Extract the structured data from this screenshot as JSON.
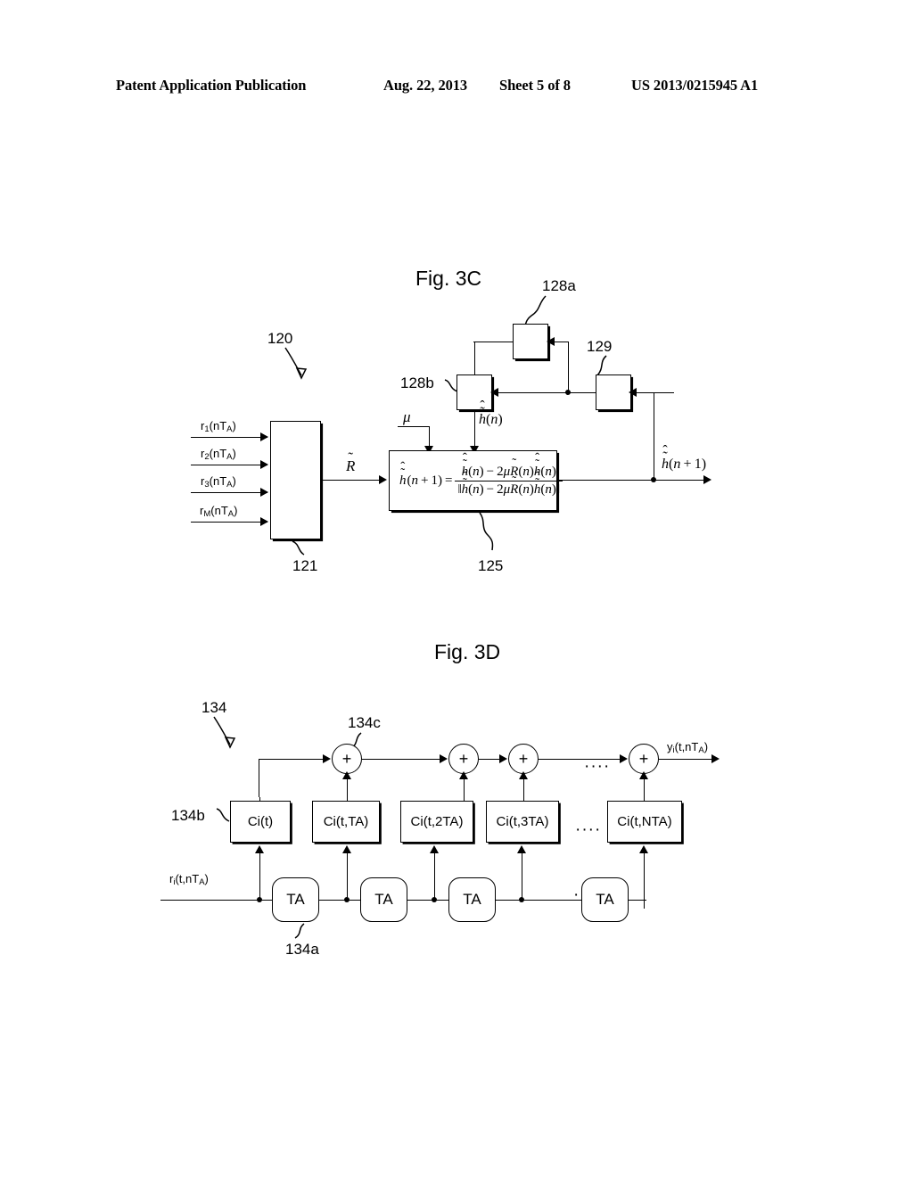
{
  "header": {
    "publication": "Patent Application Publication",
    "date": "Aug. 22, 2013",
    "sheet": "Sheet 5 of 8",
    "patent_number": "US 2013/0215945 A1"
  },
  "fig3c": {
    "title": "Fig. 3C",
    "refs": {
      "system": "120",
      "correlator": "121",
      "update_block": "125",
      "delay_128a": "128a",
      "delay_128b": "128b",
      "block_129": "129"
    },
    "inputs": [
      {
        "base": "r",
        "sub": "1",
        "tail": "(nT",
        "tailsub": "A",
        "close": ")"
      },
      {
        "base": "r",
        "sub": "2",
        "tail": "(nT",
        "tailsub": "A",
        "close": ")"
      },
      {
        "base": "r",
        "sub": "3",
        "tail": "(nT",
        "tailsub": "A",
        "close": ")"
      },
      {
        "base": "r",
        "sub": "M",
        "tail": "(nT",
        "tailsub": "A",
        "close": ")"
      }
    ],
    "signals": {
      "correlation_matrix": "R",
      "mu": "μ",
      "h_n": "h(n)",
      "h_n_plus_1": "h(n+1)"
    },
    "equation": {
      "lhs": "h(n+1)",
      "equals": "=",
      "numerator": "h(n) − 2μR(n)h(n)",
      "denominator": "‖h(n) − 2μR(n)h(n)‖"
    }
  },
  "fig3d": {
    "title": "Fig. 3D",
    "refs": {
      "filter": "134",
      "delay_element": "134a",
      "coefficient_block": "134b",
      "adder": "134c"
    },
    "input_label": {
      "base": "r",
      "sub": "i",
      "tail": "(t,nT",
      "tailsub": "A",
      "close": ")"
    },
    "output_label": {
      "base": "y",
      "sub": "i",
      "tail": "(t,nT",
      "tailsub": "A",
      "close": ")"
    },
    "coefficient_boxes": [
      "Ci(t)",
      "Ci(t,TA)",
      "Ci(t,2TA)",
      "Ci(t,3TA)",
      "Ci(t,NTA)"
    ],
    "delay_boxes": [
      "TA",
      "TA",
      "TA",
      "TA"
    ],
    "adder_symbol": "+",
    "ellipsis": "····",
    "num_adders": 4
  }
}
